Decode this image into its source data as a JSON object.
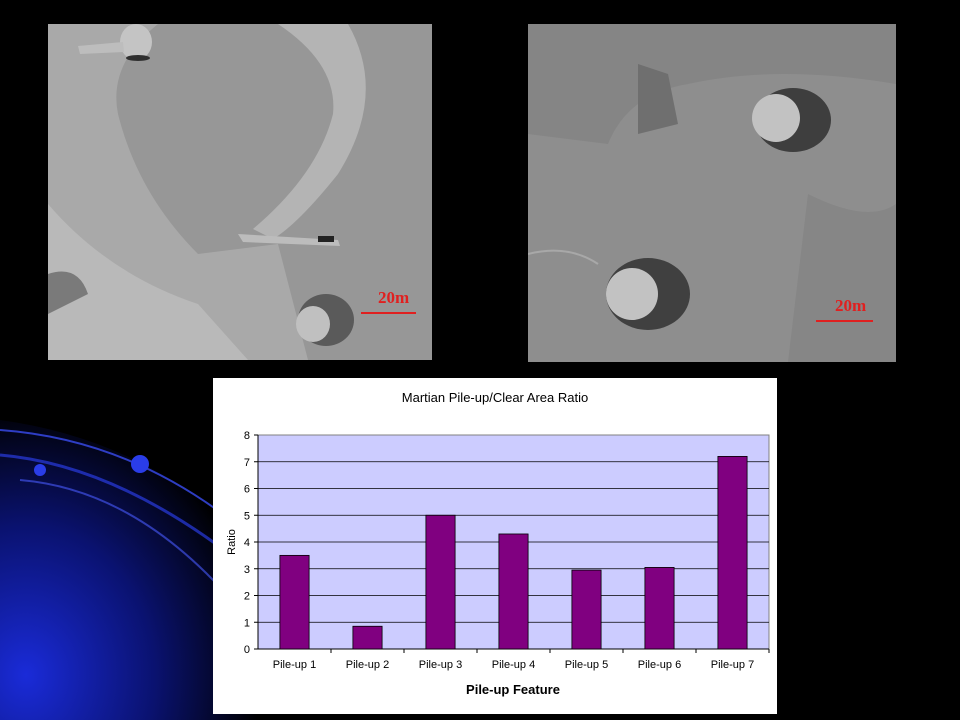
{
  "photos": {
    "left": {
      "scale_label": "20m"
    },
    "right": {
      "scale_label": "20m"
    }
  },
  "colors": {
    "background": "#000000",
    "plot_area": "#ccccff",
    "bar": "#800080",
    "scale_marker": "#e02020",
    "swoosh": "#1a2bd8"
  },
  "chart_data": {
    "type": "bar",
    "title": "Martian Pile-up/Clear Area Ratio",
    "xlabel": "Pile-up Feature",
    "ylabel": "Ratio",
    "categories": [
      "Pile-up 1",
      "Pile-up 2",
      "Pile-up 3",
      "Pile-up 4",
      "Pile-up 5",
      "Pile-up 6",
      "Pile-up 7"
    ],
    "values": [
      3.5,
      0.85,
      5.0,
      4.3,
      2.95,
      3.05,
      7.2
    ],
    "ylim": [
      0,
      8
    ],
    "yticks": [
      0,
      1,
      2,
      3,
      4,
      5,
      6,
      7,
      8
    ],
    "grid": true,
    "legend": "none"
  }
}
